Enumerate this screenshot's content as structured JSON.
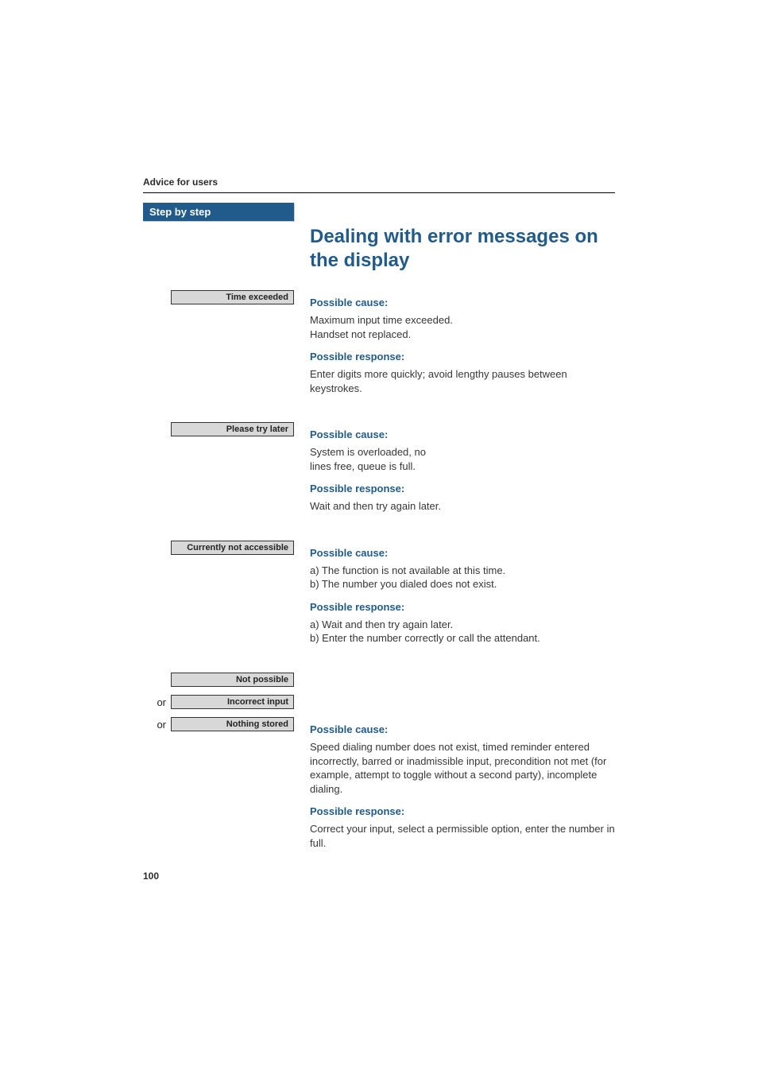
{
  "header": "Advice for users",
  "sidebar": {
    "title": "Step by step",
    "items": [
      {
        "label": "Time exceeded",
        "or": false
      },
      {
        "label": "Please try later",
        "or": false
      },
      {
        "label": "Currently not accessible",
        "or": false
      },
      {
        "label": "Not possible",
        "or": false
      },
      {
        "label": "Incorrect input",
        "or": true
      },
      {
        "label": "Nothing stored",
        "or": true
      }
    ]
  },
  "main": {
    "title": "Dealing with error messages on the display",
    "sections": [
      {
        "cause_heading": "Possible cause:",
        "cause_lines": [
          "Maximum input time exceeded.",
          "Handset not replaced."
        ],
        "response_heading": "Possible response:",
        "response_lines": [
          "Enter digits more quickly; avoid lengthy pauses between keystrokes."
        ]
      },
      {
        "cause_heading": "Possible cause:",
        "cause_lines": [
          "System is overloaded, no",
          "lines free, queue is full."
        ],
        "response_heading": "Possible response:",
        "response_lines": [
          "Wait and then try again later."
        ]
      },
      {
        "cause_heading": "Possible cause:",
        "cause_lines": [
          "a) The function is not available at this time.",
          "b) The number you dialed does not exist."
        ],
        "response_heading": "Possible response:",
        "response_lines": [
          "a) Wait and then try again later.",
          "b) Enter the number correctly or call the attendant."
        ]
      },
      {
        "cause_heading": "Possible cause:",
        "cause_lines": [
          "Speed dialing number does not exist, timed reminder entered incorrectly, barred or inadmissible input, precondition not met (for example, attempt to toggle without a second party), incomplete dialing."
        ],
        "response_heading": "Possible response:",
        "response_lines": [
          "Correct your input, select a permissible option, enter the number in full."
        ]
      }
    ]
  },
  "page_number": "100",
  "or_label": "or"
}
